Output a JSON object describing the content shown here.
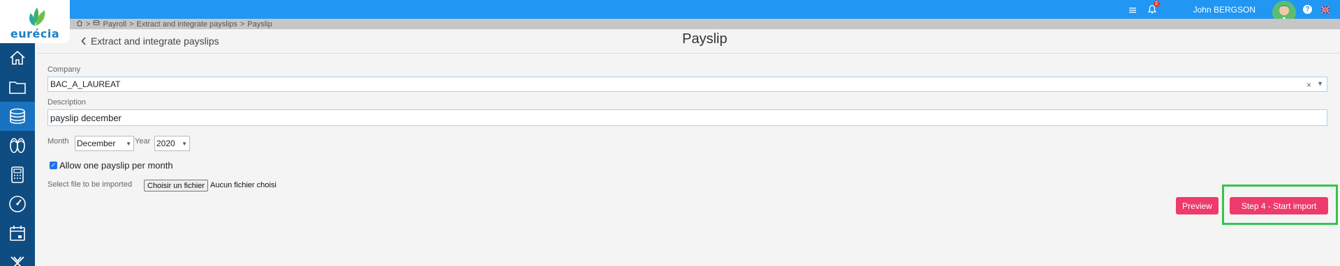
{
  "topbar": {
    "notification_count": "2",
    "username": "John  BERGSON",
    "help_label": "?",
    "icons": [
      "chart-bars-icon",
      "bell-icon",
      "help-icon",
      "uk-flag-icon"
    ]
  },
  "breadcrumb": {
    "separator1": ">",
    "item1": "Payroll",
    "separator2": ">",
    "item2": "Extract and integrate payslips",
    "separator3": ">",
    "item3": "Payslip"
  },
  "logo": {
    "text": "eurécia"
  },
  "sidebar": {
    "items": [
      "home-icon",
      "folder-icon",
      "coins-icon",
      "sandals-icon",
      "calculator-icon",
      "gauge-icon",
      "calendar-icon",
      "x-app-icon"
    ],
    "active_index": 2
  },
  "header": {
    "back_label": "Extract and integrate payslips",
    "title": "Payslip"
  },
  "form": {
    "company_label": "Company",
    "company_value": "BAC_A_LAUREAT",
    "company_clear": "×",
    "description_label": "Description",
    "description_value": "payslip december",
    "month_label": "Month",
    "month_value": "December",
    "year_label": "Year",
    "year_value": "2020",
    "allow_label": "Allow one payslip per month",
    "allow_checked": true,
    "file_label": "Select file to be imported",
    "file_button": "Choisir un fichier",
    "file_status": "Aucun fichier choisi"
  },
  "actions": {
    "preview_label": "Preview",
    "start_label": "Step 4 - Start import"
  },
  "colors": {
    "topbar": "#2196f3",
    "sidebar": "#0f4c81",
    "accent_pink": "#ee3b6c",
    "highlight_green": "#35c34e"
  }
}
